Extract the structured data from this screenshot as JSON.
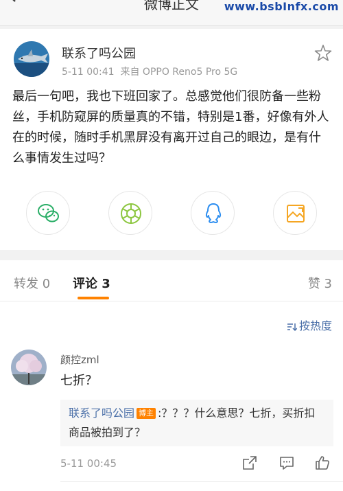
{
  "header": {
    "title": "微博正文",
    "watermark": "www.bsbInfx.com"
  },
  "post": {
    "username": "联系了吗公园",
    "timestamp": "5-11 00:41",
    "source": "来自 OPPO Reno5 Pro 5G",
    "body": "最后一句吧，我也下班回家了。总感觉他们很防备一些粉丝，手机防窥屏的质量真的不错，特别是1番，好像有外人在的时候，随时手机黑屏没有离开过自己的眼边，是有什么事情发生过吗？",
    "share_icons": [
      "wechat-icon",
      "moments-icon",
      "qq-icon",
      "share-image-icon"
    ]
  },
  "tabs": [
    {
      "label": "转发 0"
    },
    {
      "label": "评论 3"
    },
    {
      "label": "赞 3"
    }
  ],
  "comments": {
    "sort_label": "按热度",
    "items": [
      {
        "username": "颜控zml",
        "text": "七折？",
        "reply": {
          "username": "联系了吗公园",
          "badge": "博主",
          "text": ":？？？什么意思？七折，买折扣商品被拍到了？"
        },
        "time": "5-11 00:45"
      }
    ]
  },
  "colors": {
    "accent": "#ff8200",
    "link": "#4a6fa8",
    "wechat": "#2aae67",
    "qq": "#2d8ef0"
  }
}
